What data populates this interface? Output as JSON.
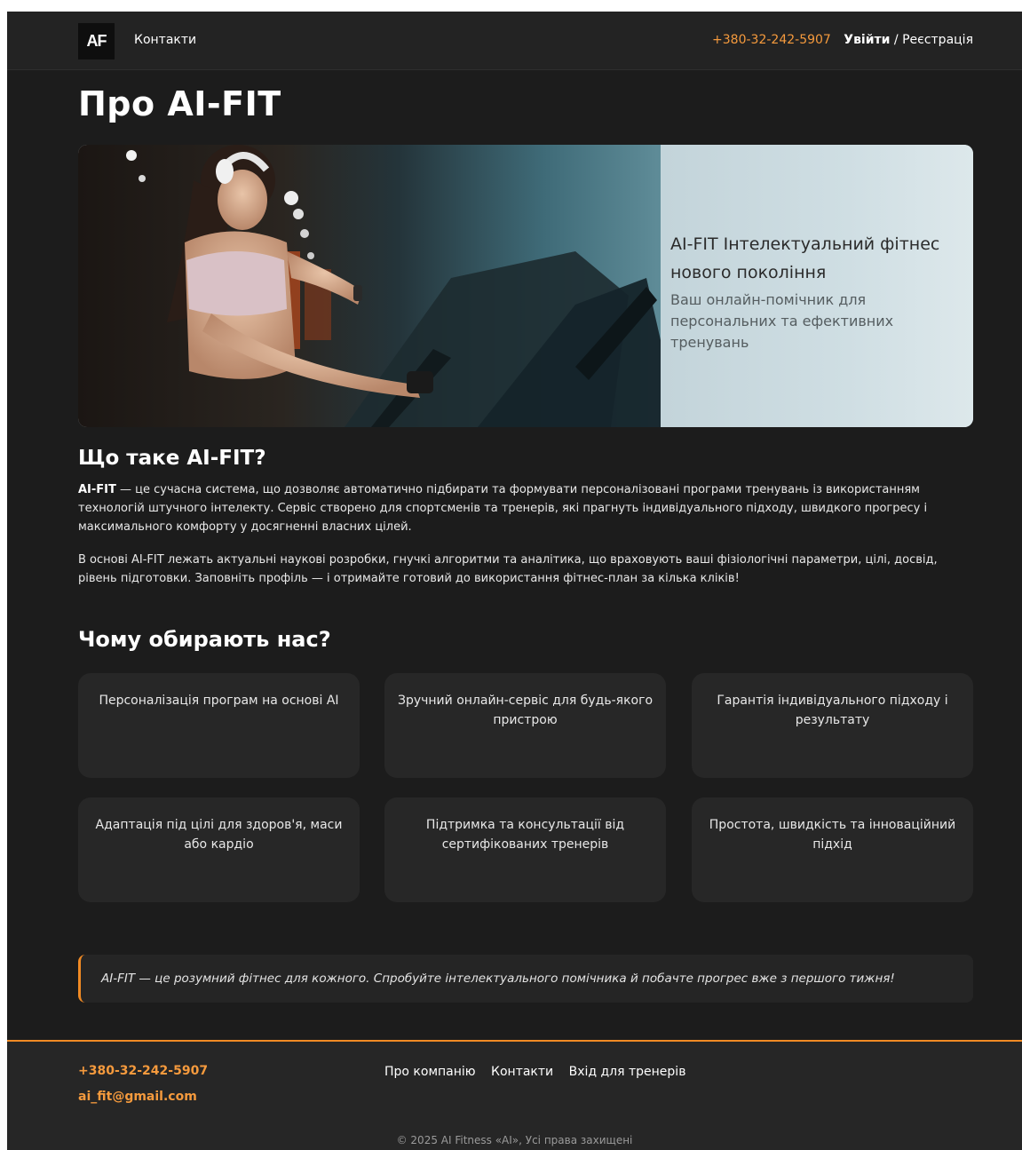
{
  "header": {
    "logo": "AF",
    "nav_contacts": "Контакти",
    "phone": "+380-32-242-5907",
    "login": "Увійти",
    "separator": "/",
    "register": "Реєстрація"
  },
  "page_title": "Про AI-FIT",
  "hero": {
    "title": "AI-FIT Інтелектуальний фітнес нового покоління",
    "subtitle": "Ваш онлайн-помічник для персональних та ефективних тренувань"
  },
  "about": {
    "heading": "Що таке AI-FIT?",
    "brand": "AI-FIT",
    "p1_rest": " — це сучасна система, що дозволяє автоматично підбирати та формувати персоналізовані програми тренувань із використанням технологій штучного інтелекту. Сервіс створено для спортсменів та тренерів, які прагнуть індивідуального підходу, швидкого прогресу і максимального комфорту у досягненні власних цілей.",
    "p2": "В основі AI-FIT лежать актуальні наукові розробки, гнучкі алгоритми та аналітика, що враховують ваші фізіологічні параметри, цілі, досвід, рівень підготовки. Заповніть профіль — і отримайте готовий до використання фітнес-план за кілька кліків!"
  },
  "why": {
    "heading": "Чому обирають нас?",
    "features": [
      "Персоналізація програм на основі AI",
      "Зручний онлайн-сервіс для будь-якого пристрою",
      "Гарантія індивідуального підходу і результату",
      "Адаптація під цілі для здоров'я, маси або кардіо",
      "Підтримка та консультації від сертифікованих тренерів",
      "Простота, швидкість та інноваційний підхід"
    ]
  },
  "quote": "AI-FIT — це розумний фітнес для кожного. Спробуйте інтелектуального помічника й побачте прогрес вже з першого тижня!",
  "footer": {
    "phone": "+380-32-242-5907",
    "email": "ai_fit@gmail.com",
    "nav": [
      "Про компанію",
      "Контакти",
      "Вхід для тренерів"
    ],
    "copyright": "© 2025 AI Fitness «AI», Усі права захищені"
  },
  "colors": {
    "accent": "#f59a3d",
    "background": "#1c1c1c",
    "card": "#272727"
  }
}
